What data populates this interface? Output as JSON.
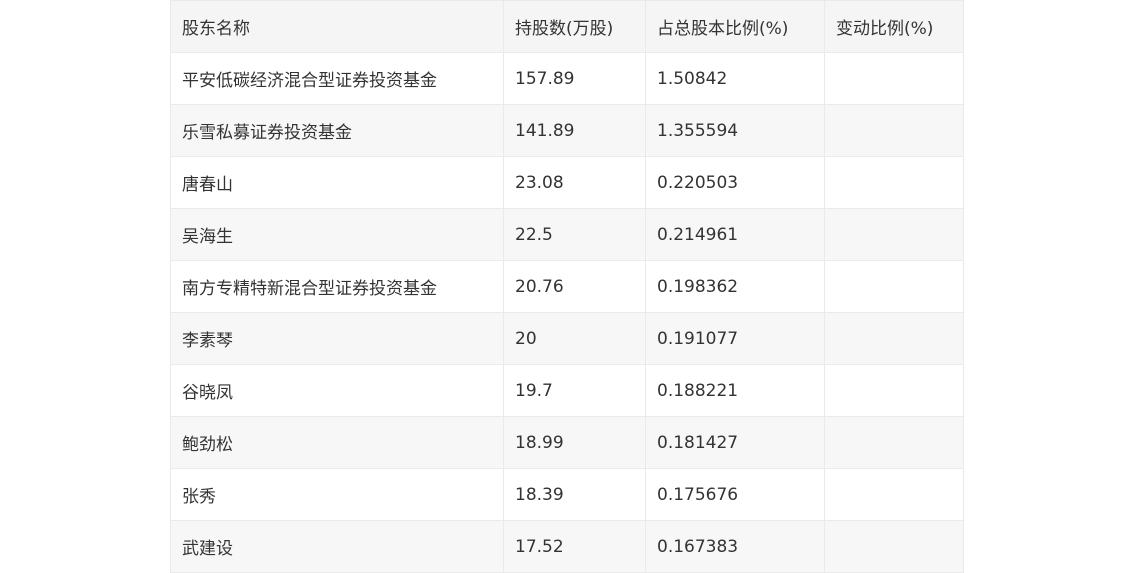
{
  "table": {
    "headers": [
      "股东名称",
      "持股数(万股)",
      "占总股本比例(%)",
      "变动比例(%)"
    ],
    "rows": [
      [
        "平安低碳经济混合型证券投资基金",
        "157.89",
        "1.50842",
        ""
      ],
      [
        "乐雪私募证券投资基金",
        "141.89",
        "1.355594",
        ""
      ],
      [
        "唐春山",
        "23.08",
        "0.220503",
        ""
      ],
      [
        "吴海生",
        "22.5",
        "0.214961",
        ""
      ],
      [
        "南方专精特新混合型证券投资基金",
        "20.76",
        "0.198362",
        ""
      ],
      [
        "李素琴",
        "20",
        "0.191077",
        ""
      ],
      [
        "谷晓凤",
        "19.7",
        "0.188221",
        ""
      ],
      [
        "鲍劲松",
        "18.99",
        "0.181427",
        ""
      ],
      [
        "张秀",
        "18.39",
        "0.175676",
        ""
      ],
      [
        "武建设",
        "17.52",
        "0.167383",
        ""
      ]
    ]
  }
}
